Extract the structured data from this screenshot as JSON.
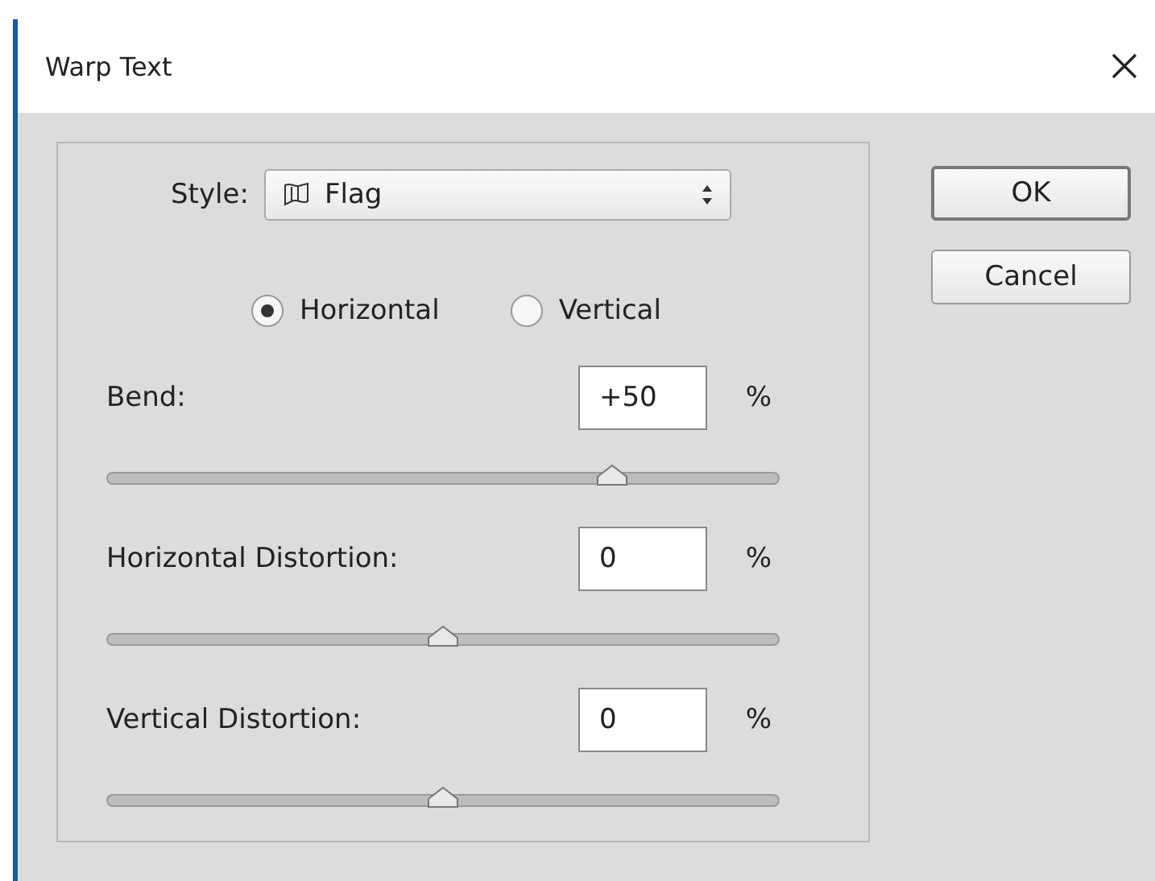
{
  "window": {
    "title": "Warp Text"
  },
  "style": {
    "label": "Style:",
    "value": "Flag"
  },
  "orientation": [
    {
      "label": "Horizontal",
      "selected": true
    },
    {
      "label": "Vertical",
      "selected": false
    }
  ],
  "sliders": [
    {
      "label": "Bend:",
      "value": "+50",
      "unit": "%",
      "level": 0.75
    },
    {
      "label": "Horizontal Distortion:",
      "value": "0",
      "unit": "%",
      "level": 0.5
    },
    {
      "label": "Vertical Distortion:",
      "value": "0",
      "unit": "%",
      "level": 0.5
    }
  ],
  "buttons": [
    "OK",
    "Cancel"
  ]
}
